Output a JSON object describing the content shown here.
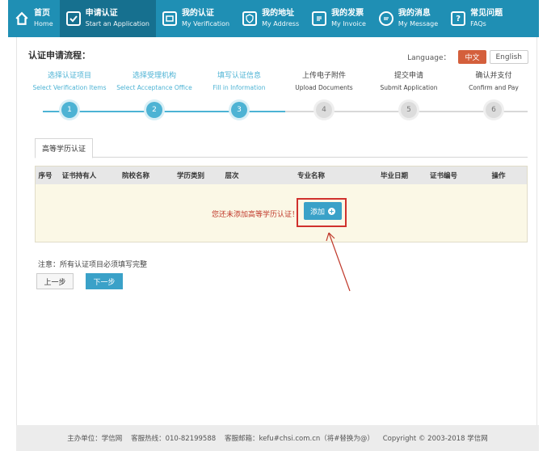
{
  "nav": {
    "items": [
      {
        "zh": "首页",
        "en": "Home",
        "icon": "home-icon",
        "active": false
      },
      {
        "zh": "申请认证",
        "en": "Start an Application",
        "icon": "check-icon",
        "active": true
      },
      {
        "zh": "我的认证",
        "en": "My Verification",
        "icon": "certificate-icon",
        "active": false
      },
      {
        "zh": "我的地址",
        "en": "My Address",
        "icon": "shield-icon",
        "active": false
      },
      {
        "zh": "我的发票",
        "en": "My Invoice",
        "icon": "invoice-icon",
        "active": false
      },
      {
        "zh": "我的消息",
        "en": "My Message",
        "icon": "message-icon",
        "active": false
      },
      {
        "zh": "常见问题",
        "en": "FAQs",
        "icon": "question-icon",
        "active": false
      }
    ]
  },
  "flow": {
    "title": "认证申请流程："
  },
  "language": {
    "label": "Language：",
    "zh": "中文",
    "en": "English"
  },
  "steps": [
    {
      "zh": "选择认证项目",
      "en": "Select Verification Items",
      "num": "1",
      "done": true
    },
    {
      "zh": "选择受理机构",
      "en": "Select Acceptance Office",
      "num": "2",
      "done": true
    },
    {
      "zh": "填写认证信息",
      "en": "Fill in Information",
      "num": "3",
      "done": true
    },
    {
      "zh": "上传电子附件",
      "en": "Upload Documents",
      "num": "4",
      "done": false
    },
    {
      "zh": "提交申请",
      "en": "Submit Application",
      "num": "5",
      "done": false
    },
    {
      "zh": "确认并支付",
      "en": "Confirm and Pay",
      "num": "6",
      "done": false
    }
  ],
  "tab": {
    "label": "高等学历认证"
  },
  "table": {
    "headers": [
      "序号",
      "证书持有人",
      "院校名称",
      "学历类别",
      "层次",
      "专业名称",
      "毕业日期",
      "证书编号",
      "操作"
    ],
    "empty_message": "您还未添加高等学历认证！",
    "add_label": "添加"
  },
  "note": "注意：所有认证项目必须填写完整",
  "buttons": {
    "prev": "上一步",
    "next": "下一步"
  },
  "footer": {
    "text": "主办单位：学信网    客服热线：010-82199588    客服邮箱：kefu#chsi.com.cn（将#替换为@）    Copyright © 2003-2018 学信网"
  },
  "colors": {
    "nav_bg": "#1f8fb4",
    "accent": "#3aa1c8",
    "lang_active": "#d45f3c",
    "highlight": "#d0312d"
  }
}
